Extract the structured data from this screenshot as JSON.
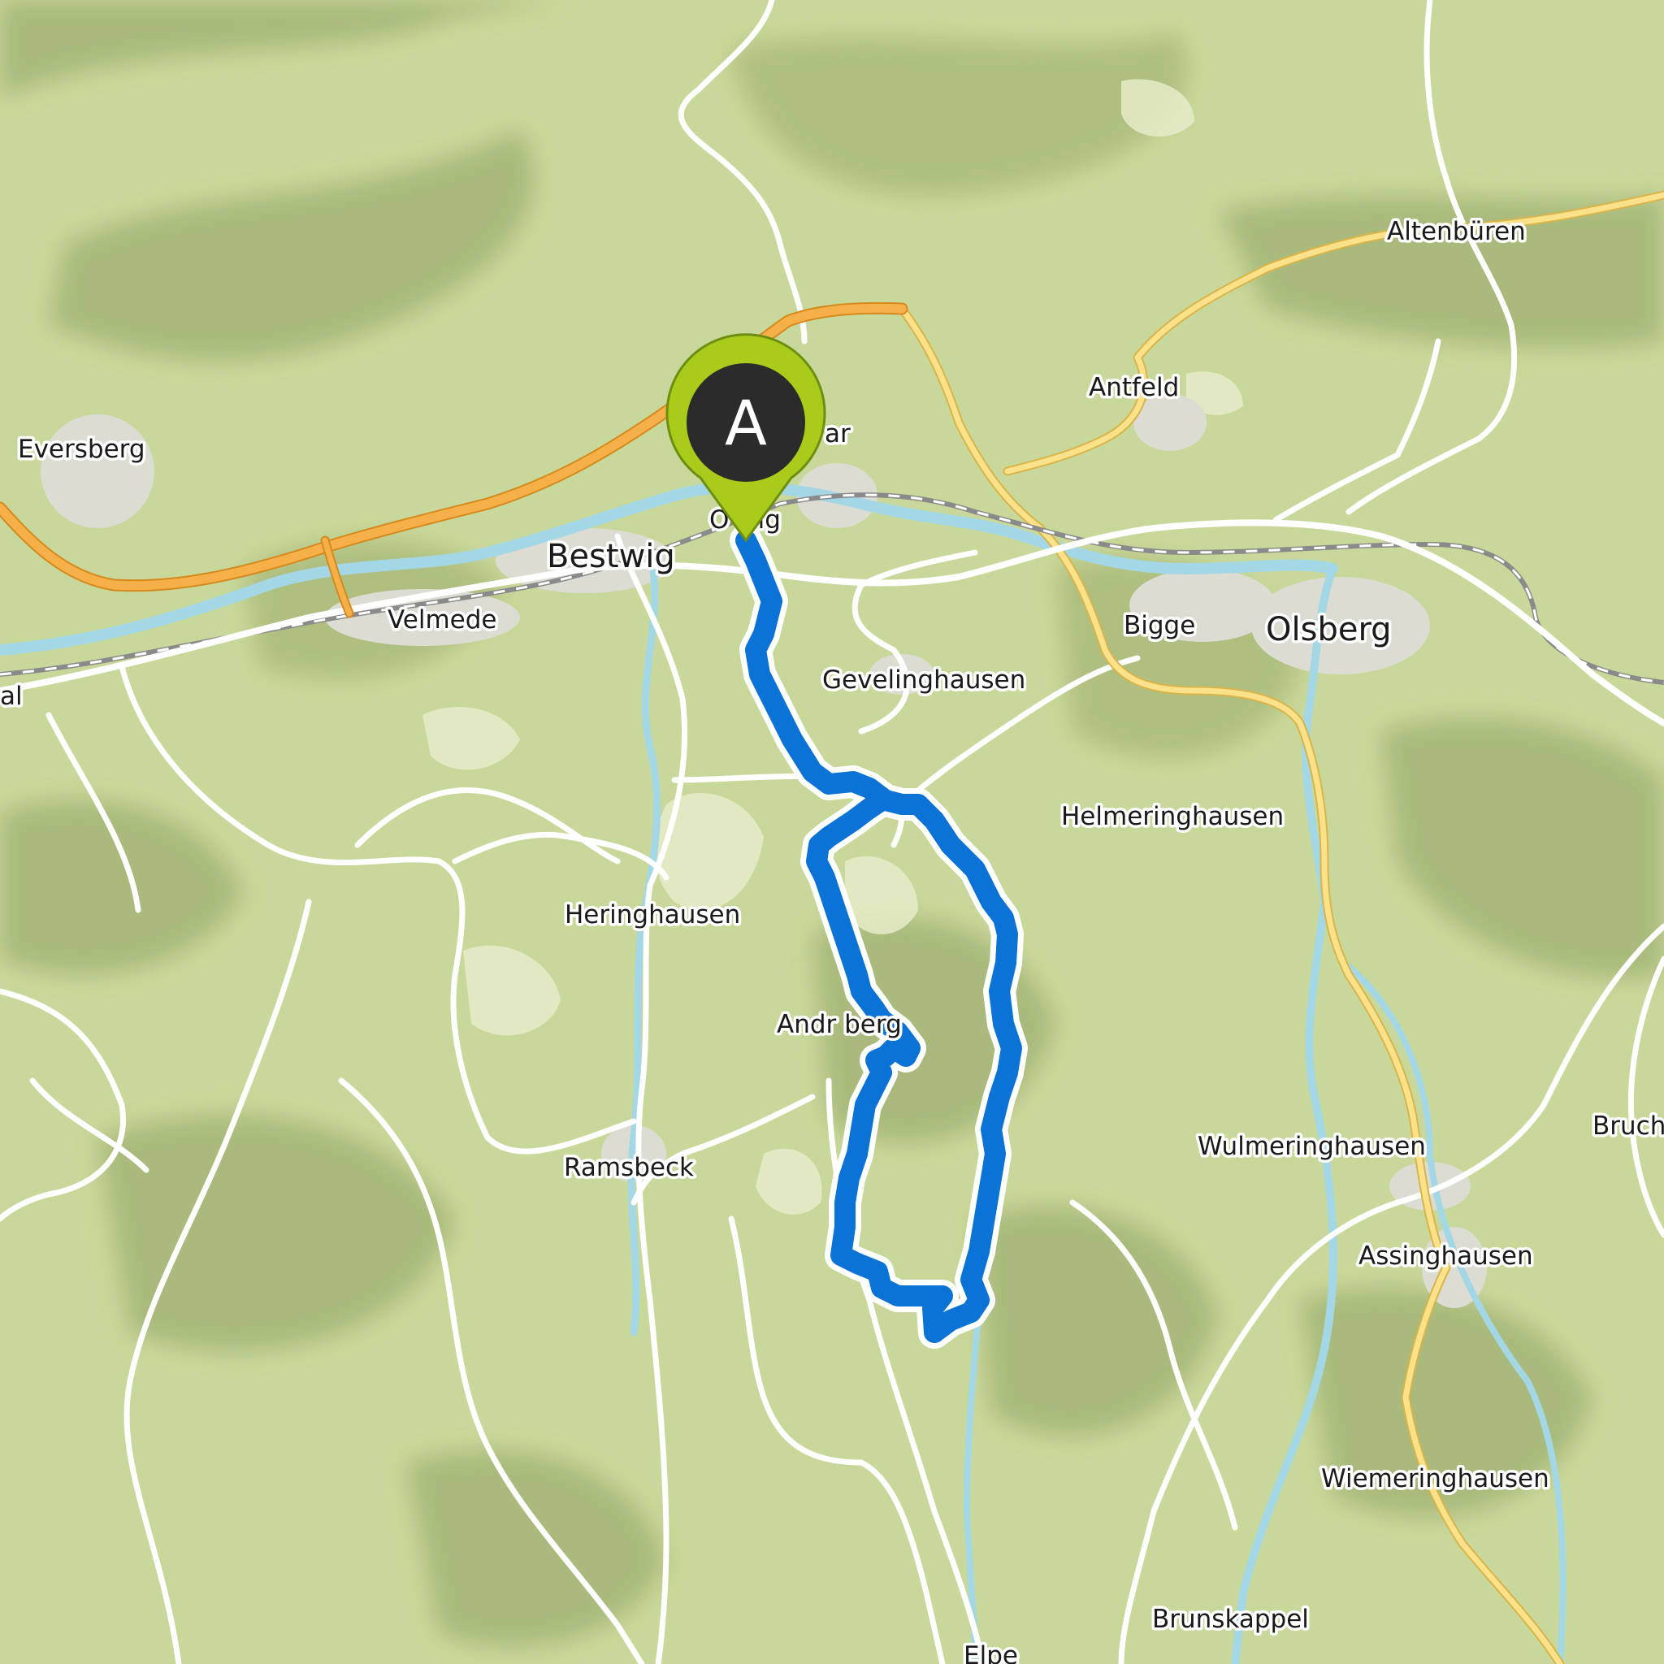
{
  "map": {
    "places": [
      {
        "id": "eversberg",
        "name": "Eversberg",
        "kind": "village"
      },
      {
        "id": "bestwig",
        "name": "Bestwig",
        "kind": "town"
      },
      {
        "id": "velmede",
        "name": "Velmede",
        "kind": "village"
      },
      {
        "id": "al",
        "name": "al",
        "kind": "village"
      },
      {
        "id": "ostwig",
        "name": "O   wig",
        "kind": "village"
      },
      {
        "id": "nuttlar",
        "name": "ar",
        "kind": "village"
      },
      {
        "id": "antfeld",
        "name": "Antfeld",
        "kind": "village"
      },
      {
        "id": "altenbueren",
        "name": "Altenbüren",
        "kind": "village"
      },
      {
        "id": "bigge",
        "name": "Bigge",
        "kind": "village"
      },
      {
        "id": "olsberg",
        "name": "Olsberg",
        "kind": "town"
      },
      {
        "id": "gevelinghausen",
        "name": "Gevelinghausen",
        "kind": "village"
      },
      {
        "id": "helmeringhausen",
        "name": "Helmeringhausen",
        "kind": "village"
      },
      {
        "id": "heringhausen",
        "name": "Heringhausen",
        "kind": "village"
      },
      {
        "id": "andreasberg",
        "name": "Andr      berg",
        "kind": "village"
      },
      {
        "id": "ramsbeck",
        "name": "Ramsbeck",
        "kind": "village"
      },
      {
        "id": "wulmeringhausen",
        "name": "Wulmeringhausen",
        "kind": "village"
      },
      {
        "id": "bruch",
        "name": "Bruch",
        "kind": "village"
      },
      {
        "id": "assinghausen",
        "name": "Assinghausen",
        "kind": "village"
      },
      {
        "id": "wiemeringhausen",
        "name": "Wiemeringhausen",
        "kind": "village"
      },
      {
        "id": "brunskappel",
        "name": "Brunskappel",
        "kind": "village"
      },
      {
        "id": "elpe",
        "name": "Elpe",
        "kind": "village"
      }
    ],
    "start_marker": {
      "label": "A"
    },
    "colors": {
      "terrain": "#c8d89a",
      "terrain_light": "#e6ebc8",
      "terrain_shade": "#9fb072",
      "settlement": "#dcdcd2",
      "route": "#0b72d6",
      "highway": "#f6b04a",
      "primary_road": "#fbe18a",
      "minor_road": "#ffffff",
      "river": "#a3d7e6",
      "railway": "#8a8a8a",
      "marker_outer": "#a9cc1b",
      "marker_inner": "#2b2b2b"
    }
  }
}
